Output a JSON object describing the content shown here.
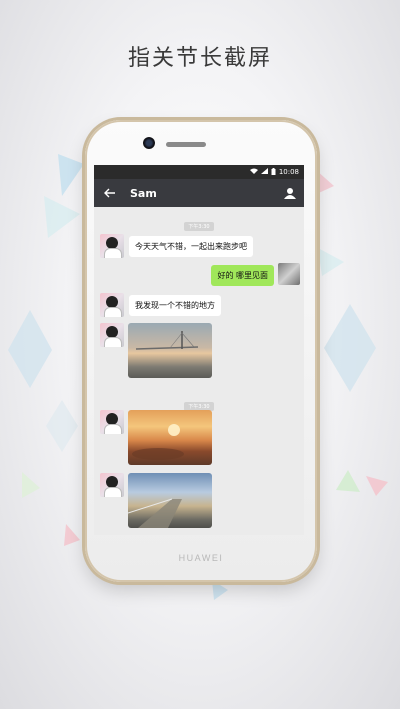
{
  "headline": "指关节长截屏",
  "phone": {
    "brand": "HUAWEI",
    "status_time": "10:08"
  },
  "chat": {
    "contact_name": "Sam",
    "timestamp_1": "下午3:30",
    "timestamp_2": "下午3:30",
    "messages": [
      {
        "side": "left",
        "text": "今天天气不错，一起出来跑步吧"
      },
      {
        "side": "right",
        "text": "好的 哪里见面"
      },
      {
        "side": "left",
        "text": "我发现一个不错的地方"
      }
    ]
  },
  "colors": {
    "titlebar": "#393a3f",
    "sent_bubble": "#a0e75a",
    "chat_background": "#ebebeb"
  }
}
